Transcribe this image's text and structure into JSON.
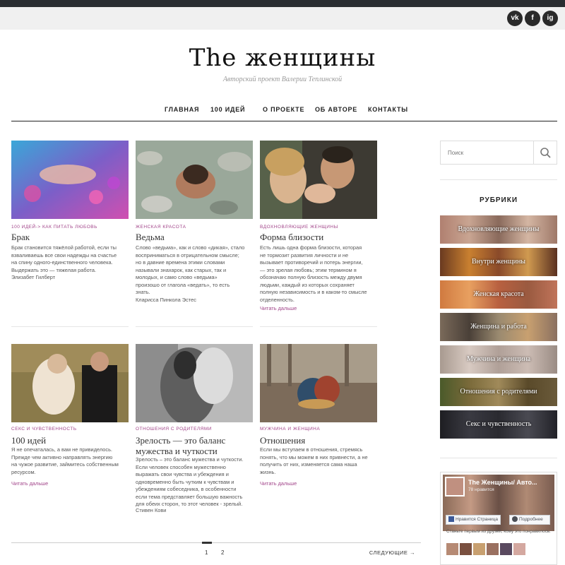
{
  "header": {
    "social": [
      "vk",
      "f",
      "ig"
    ],
    "logo": "The женщины",
    "tagline": "Авторский проект Валерии Теплинской"
  },
  "nav": [
    "ГЛАВНАЯ",
    "100 ИДЕЙ",
    "О ПРОЕКТЕ",
    "ОБ АВТОРЕ",
    "КОНТАКТЫ"
  ],
  "posts": [
    {
      "category": "100 идей-> как питать любовь",
      "title": "Брак",
      "lines": [
        "Брак становится тяжёлой работой, если ты",
        "взваливаешь все свои надежды на счастье",
        "на спину одного-единственного человека.",
        "Выдержать это — тяжелая работа.",
        "Элизабет Гилберт"
      ],
      "author": "",
      "read_more": ""
    },
    {
      "category": "Женская красота",
      "title": "Ведьма",
      "lines": [
        "Слово «ведьма», как и слово «дикая», стало",
        "восприниматься в отрицательном смысле;",
        "но в давние времена этими словами",
        "называли знахарок, как старых, так и",
        "молодых, и само слово «ведьма»",
        "произошо от глагола «ведать», то есть",
        "знать."
      ],
      "author": "Кларисса Пинкола Эстес",
      "read_more": ""
    },
    {
      "category": "Вдохновляющие женщины",
      "title": "Форма близости",
      "lines": [
        "Есть лишь одна форма близости, которая",
        "не тормозит развития личности и не",
        "вызывает противоречий и потерь энергии,",
        "— это зрелая любовь; этим термином я",
        "обозначаю полную близость между двумя",
        "людьми, каждый из которых сохраняет",
        "полную независимость и в каком-то смысле",
        "отделенность."
      ],
      "author": "",
      "read_more": "Читать дальше"
    },
    {
      "category": "Секс и чувственность",
      "title": "100 идей",
      "lines": [
        "Я не опечаталась, а вам не привиделось.",
        "Прежде чем активно направлять энергию",
        "на чужое развитие, займитесь собственным",
        "ресурсом."
      ],
      "author": "",
      "read_more": "Читать дальше"
    },
    {
      "category": "Отношения с родителями",
      "title": "Зрелость — это баланс мужества и чуткости",
      "lines": [
        "Зрелость – это баланс мужества и чуткости.",
        "Если человек способен мужественно",
        "выражать свои чувства и убеждения и",
        "одновременно быть чутким к чувствам и",
        "убеждениям собеседника, в особенности",
        "если тема представляет большую важность",
        "для обеих сторон, то этот человек - зрелый."
      ],
      "author": "Стивен Кови",
      "read_more": ""
    },
    {
      "category": "Мужчина и женщина",
      "title": "Отношения",
      "lines": [
        "Если мы вступаем в отношения, стремясь",
        "понять, что мы можем в них привнести, а не",
        "получить от них, изменяется сама наша",
        "жизнь."
      ],
      "author": "",
      "read_more": "Читать дальше"
    }
  ],
  "pagination": {
    "pages": [
      "1",
      "2"
    ],
    "current": "1",
    "next": "СЛЕДУЮЩИЕ →"
  },
  "sidebar": {
    "search_placeholder": "Поиск",
    "rubrics_title": "РУБРИКИ",
    "categories": [
      "Вдохновляющие женщины",
      "Внутри женщины",
      "Женская красота",
      "Женщина и работа",
      "Мужчина и женщина",
      "Отношения с родителями",
      "Секс и чувственность"
    ],
    "facebook": {
      "page_name": "The Женщины/ Авто...",
      "likes": "78 нравится",
      "like_button": "Нравится Страница",
      "more_button": "Подробнее",
      "friends_text": "Станьте первым из друзей, кому это понравилось."
    }
  },
  "colors": {
    "accent": "#a2458a",
    "topbar": "#2a2d31",
    "text": "#444444"
  }
}
